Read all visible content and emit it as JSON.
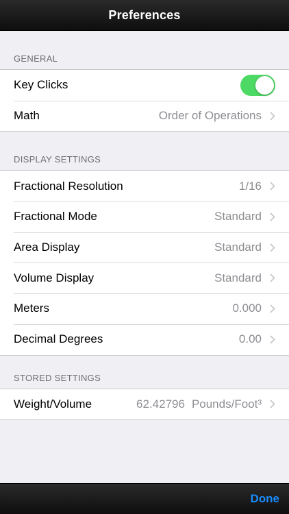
{
  "navbar": {
    "title": "Preferences"
  },
  "sections": {
    "general": {
      "header": "GENERAL",
      "key_clicks": {
        "label": "Key Clicks",
        "enabled": true,
        "accent": "#4cd964"
      },
      "math": {
        "label": "Math",
        "value": "Order of Operations"
      }
    },
    "display": {
      "header": "DISPLAY SETTINGS",
      "fractional_resolution": {
        "label": "Fractional Resolution",
        "value": "1/16"
      },
      "fractional_mode": {
        "label": "Fractional Mode",
        "value": "Standard"
      },
      "area_display": {
        "label": "Area Display",
        "value": "Standard"
      },
      "volume_display": {
        "label": "Volume Display",
        "value": "Standard"
      },
      "meters": {
        "label": "Meters",
        "value": "0.000"
      },
      "decimal_degrees": {
        "label": "Decimal Degrees",
        "value": "0.00"
      }
    },
    "stored": {
      "header": "STORED SETTINGS",
      "weight_volume": {
        "label": "Weight/Volume",
        "number": "62.42796",
        "unit": "Pounds/Foot³"
      }
    }
  },
  "toolbar": {
    "done_label": "Done",
    "accent": "#1a8cff"
  },
  "icons": {
    "disclosure": "chevron-right-icon"
  }
}
